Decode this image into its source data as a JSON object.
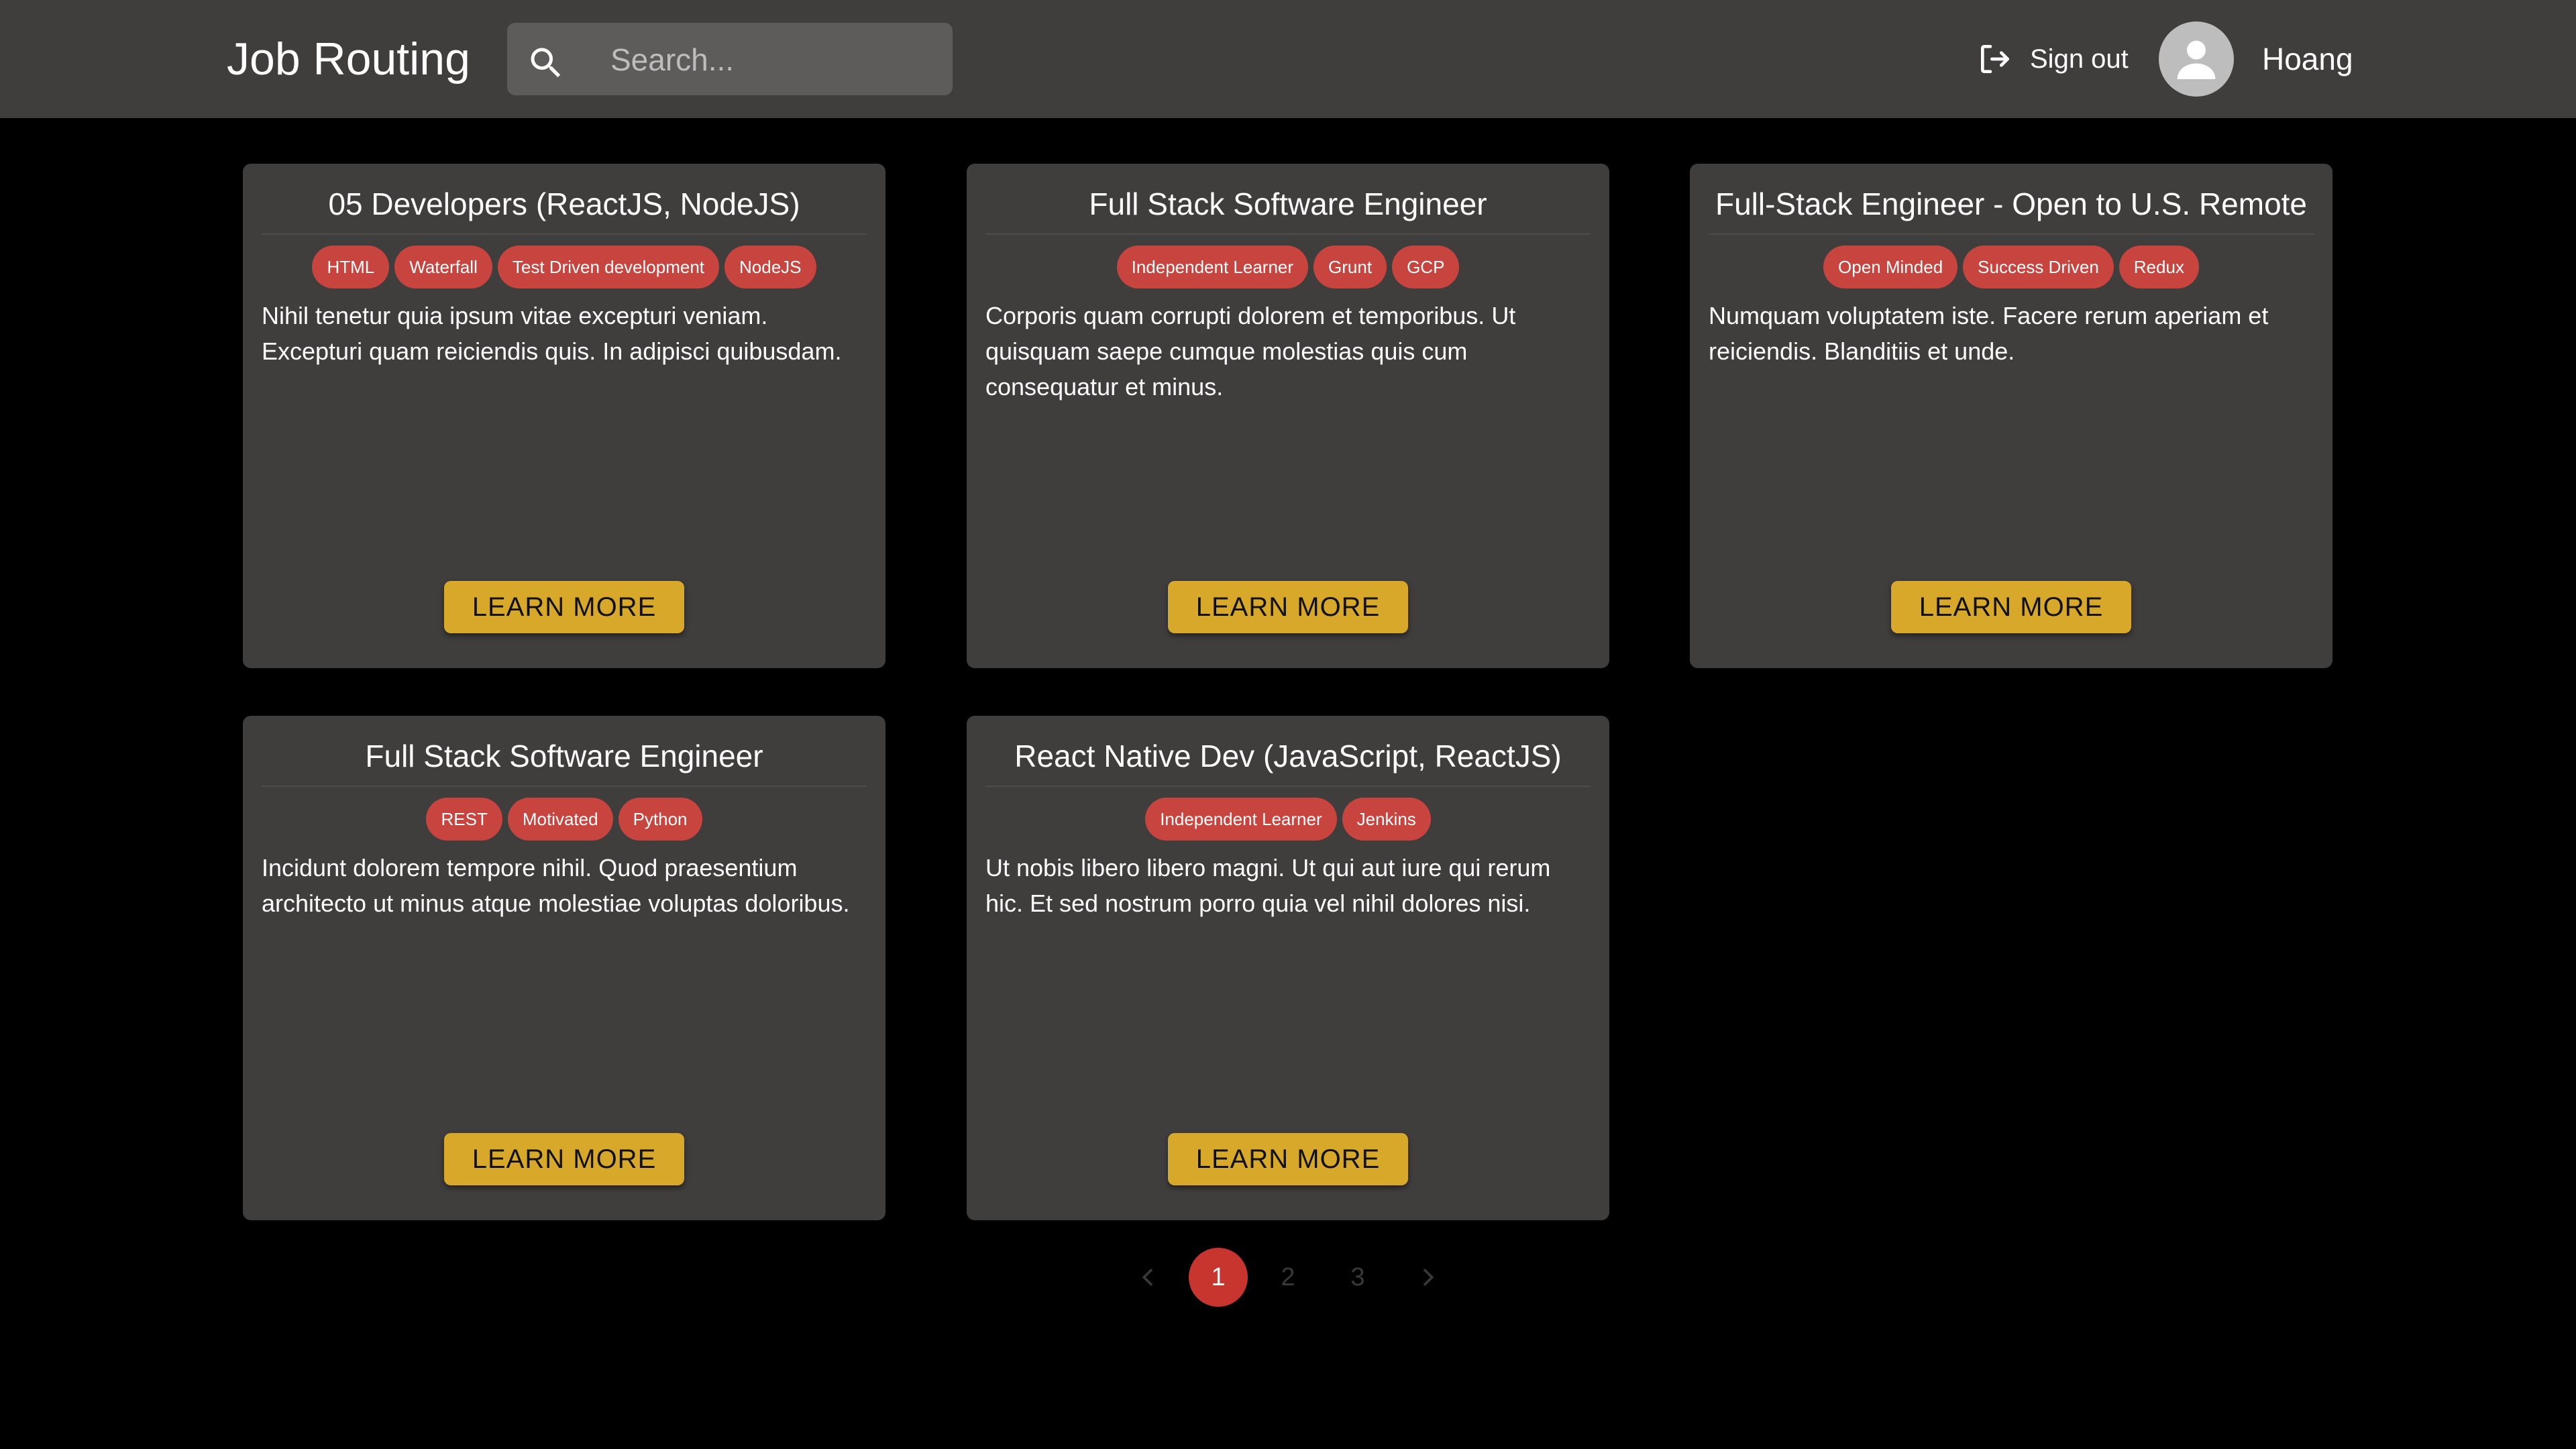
{
  "app": {
    "title": "Job Routing"
  },
  "search": {
    "placeholder": "Search...",
    "value": ""
  },
  "user": {
    "signout_label": "Sign out",
    "name": "Hoang"
  },
  "jobs": [
    {
      "title": "05 Developers (ReactJS, NodeJS)",
      "tags": [
        "HTML",
        "Waterfall",
        "Test Driven development",
        "NodeJS"
      ],
      "description": "Nihil tenetur quia ipsum vitae excepturi veniam. Excepturi quam reiciendis quis. In adipisci quibusdam.",
      "button_label": "LEARN MORE"
    },
    {
      "title": "Full Stack Software Engineer",
      "tags": [
        "Independent Learner",
        "Grunt",
        "GCP"
      ],
      "description": "Corporis quam corrupti dolorem et temporibus. Ut quisquam saepe cumque molestias quis cum consequatur et minus.",
      "button_label": "LEARN MORE"
    },
    {
      "title": "Full-Stack Engineer - Open to U.S. Remote",
      "tags": [
        "Open Minded",
        "Success Driven",
        "Redux"
      ],
      "description": "Numquam voluptatem iste. Facere rerum aperiam et reiciendis. Blanditiis et unde.",
      "button_label": "LEARN MORE"
    },
    {
      "title": "Full Stack Software Engineer",
      "tags": [
        "REST",
        "Motivated",
        "Python"
      ],
      "description": "Incidunt dolorem tempore nihil. Quod praesentium architecto ut minus atque molestiae voluptas doloribus.",
      "button_label": "LEARN MORE"
    },
    {
      "title": "React Native Dev (JavaScript, ReactJS)",
      "tags": [
        "Independent Learner",
        "Jenkins"
      ],
      "description": "Ut nobis libero libero magni. Ut qui aut iure qui rerum hic. Et sed nostrum porro quia vel nihil dolores nisi.",
      "button_label": "LEARN MORE"
    }
  ],
  "pagination": {
    "pages": [
      "1",
      "2",
      "3"
    ],
    "current": "1"
  },
  "colors": {
    "header_bg": "#403d3d",
    "card_bg": "#403d3d",
    "tag_bg": "#c8443f",
    "button_bg": "#d7a82a",
    "active_page": "#c8342e"
  }
}
